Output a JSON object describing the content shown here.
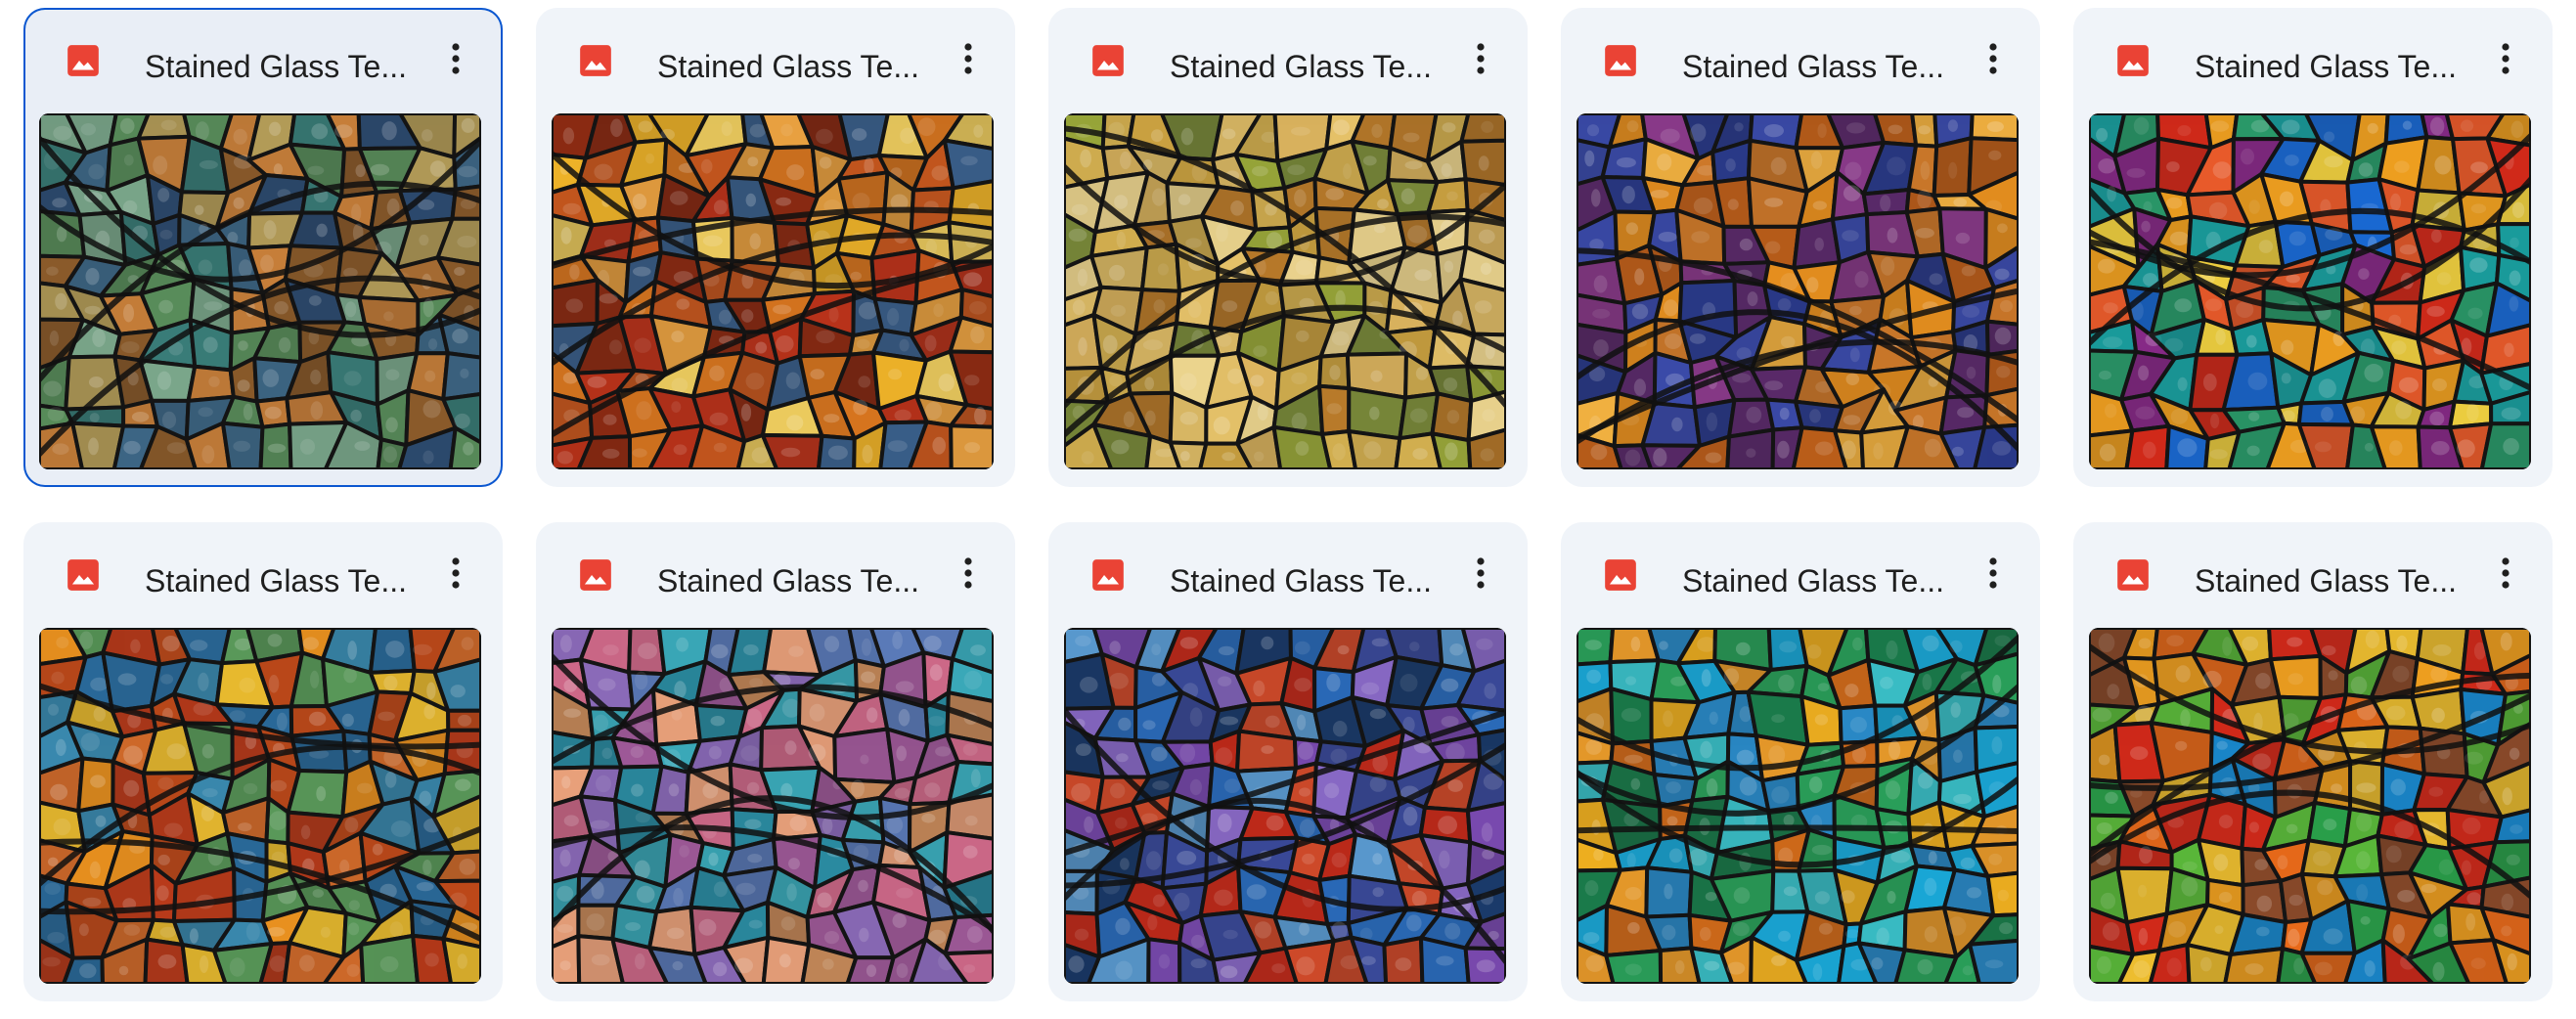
{
  "files": [
    {
      "title": "Stained Glass Te...",
      "selected": true,
      "palette": [
        "#3f6a8a",
        "#5a8f5c",
        "#c9803a",
        "#2c4a6e",
        "#7aa68a",
        "#b8a05a",
        "#3a7f7a",
        "#8a5a2a"
      ]
    },
    {
      "title": "Stained Glass Te...",
      "selected": false,
      "palette": [
        "#d9761f",
        "#b8321a",
        "#f0b429",
        "#8a2a12",
        "#e8a040",
        "#3a5f8a",
        "#c4561e",
        "#f2d060"
      ]
    },
    {
      "title": "Stained Glass Te...",
      "selected": false,
      "palette": [
        "#e8c46a",
        "#c9a040",
        "#9aa83a",
        "#f0d890",
        "#b87a2a",
        "#d4b050",
        "#7a8a3a",
        "#e0b860"
      ]
    },
    {
      "title": "Stained Glass Te...",
      "selected": false,
      "palette": [
        "#e8901f",
        "#c0601a",
        "#3a4aa8",
        "#8a3a8a",
        "#f0b040",
        "#5a2a6a",
        "#d07a2a",
        "#2a3a8a"
      ]
    },
    {
      "title": "Stained Glass Te...",
      "selected": false,
      "palette": [
        "#d42a1a",
        "#1a6ad4",
        "#f0a020",
        "#2a9a6a",
        "#e85a2a",
        "#8a2a8a",
        "#f0d040",
        "#1aa0a0"
      ]
    },
    {
      "title": "Stained Glass Te...",
      "selected": false,
      "palette": [
        "#e8901f",
        "#3a8ab0",
        "#c04a1a",
        "#f0c030",
        "#5a9a5a",
        "#d06a2a",
        "#2a6a9a",
        "#b83a1a"
      ]
    },
    {
      "title": "Stained Glass Te...",
      "selected": false,
      "palette": [
        "#3aa8b8",
        "#8a6ab8",
        "#d06a8a",
        "#5a7ab8",
        "#c88a5a",
        "#2a8aa0",
        "#a05a9a",
        "#e8a07a"
      ]
    },
    {
      "title": "Stained Glass Te...",
      "selected": false,
      "palette": [
        "#2a6ab8",
        "#7a4ab0",
        "#5a9ad0",
        "#c02a1a",
        "#3a4a9a",
        "#8a6ac8",
        "#1a3a6a",
        "#d04a2a"
      ]
    },
    {
      "title": "Stained Glass Te...",
      "selected": false,
      "palette": [
        "#1aa8d8",
        "#2aa05a",
        "#f0b020",
        "#d06a1a",
        "#3ac0c8",
        "#1a7a4a",
        "#e89a2a",
        "#2a8ac8"
      ]
    },
    {
      "title": "Stained Glass Te...",
      "selected": false,
      "palette": [
        "#d42a1a",
        "#2aa04a",
        "#f0a020",
        "#1a8ad0",
        "#e86a1a",
        "#5ab83a",
        "#8a4a2a",
        "#f0c030"
      ]
    }
  ]
}
